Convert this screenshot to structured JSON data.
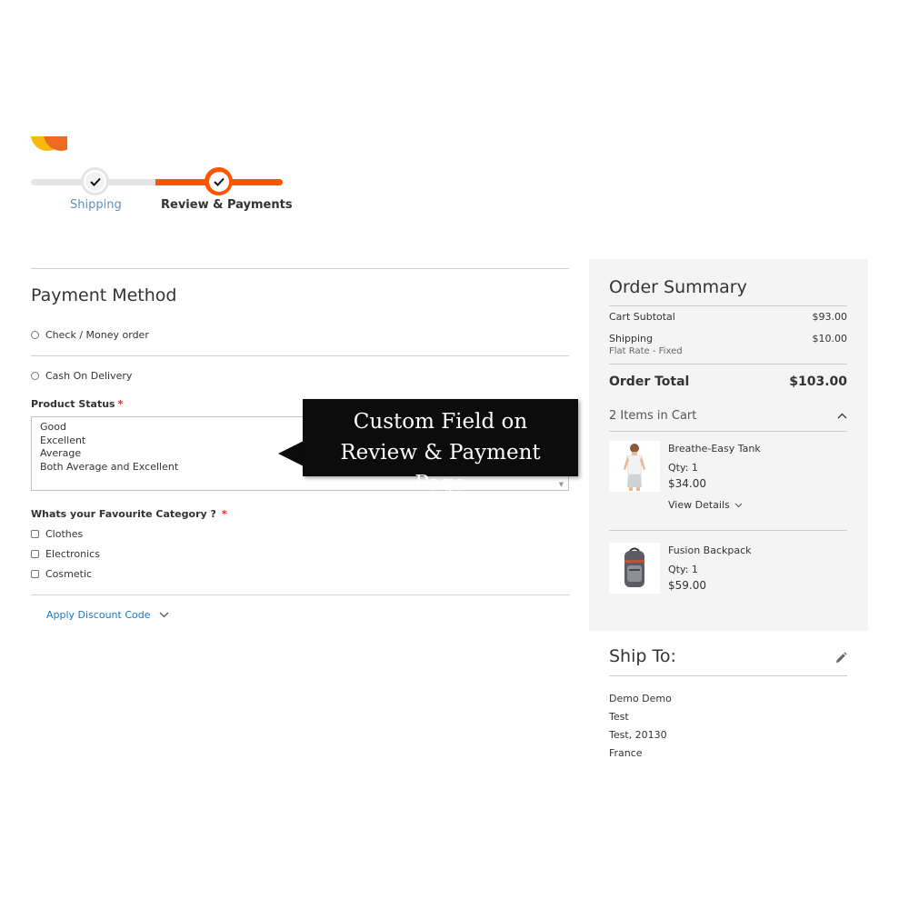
{
  "progress": {
    "steps": [
      {
        "label": "Shipping",
        "state": "complete"
      },
      {
        "label": "Review & Payments",
        "state": "active"
      }
    ]
  },
  "payment": {
    "title": "Payment Method",
    "methods": [
      "Check / Money order",
      "Cash On Delivery"
    ],
    "product_status": {
      "label": "Product Status",
      "required": "*",
      "options": [
        "Good",
        "Excellent",
        "Average",
        "Both Average and Excellent"
      ]
    },
    "favourite_category": {
      "label": "Whats your Favourite Category ?",
      "required": "*",
      "options": [
        "Clothes",
        "Electronics",
        "Cosmetic"
      ]
    },
    "discount_label": "Apply Discount Code"
  },
  "tooltip": {
    "text": "Custom Field on Review & Payment Page"
  },
  "summary": {
    "title": "Order Summary",
    "subtotal_label": "Cart Subtotal",
    "subtotal_value": "$93.00",
    "shipping_label": "Shipping",
    "shipping_value": "$10.00",
    "shipping_method": "Flat Rate - Fixed",
    "total_label": "Order Total",
    "total_value": "$103.00",
    "items_in_cart": "2 Items in Cart",
    "items": [
      {
        "name": "Breathe-Easy Tank",
        "qty": "Qty: 1",
        "price": "$34.00",
        "details": "View Details"
      },
      {
        "name": "Fusion Backpack",
        "qty": "Qty: 1",
        "price": "$59.00"
      }
    ]
  },
  "ship_to": {
    "title": "Ship To:",
    "lines": [
      "Demo Demo",
      "Test",
      "Test, 20130",
      "France"
    ]
  },
  "colors": {
    "accent": "#ff5501",
    "link": "#1979c3",
    "step_label": "#5a8fc8",
    "summary_bg": "#f4f4f4"
  },
  "icons": [
    "checkmark-icon",
    "chevron-down-icon",
    "chevron-up-icon",
    "pencil-icon"
  ]
}
